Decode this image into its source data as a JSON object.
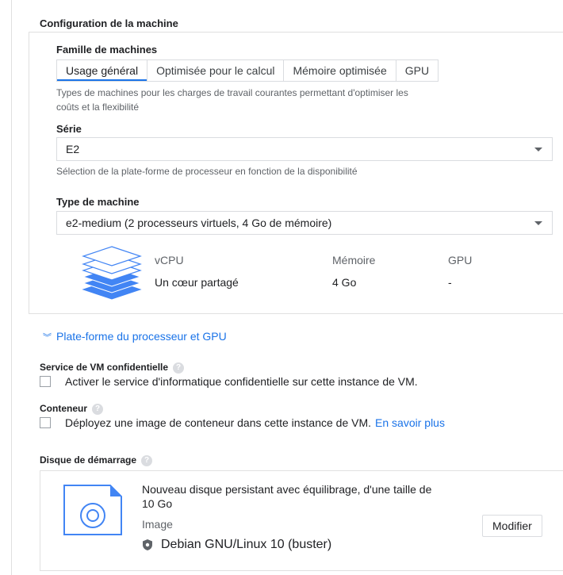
{
  "machine_config": {
    "title": "Configuration de la machine",
    "family": {
      "label": "Famille de machines",
      "tabs": [
        "Usage général",
        "Optimisée pour le calcul",
        "Mémoire optimisée",
        "GPU"
      ],
      "selected": "Usage général",
      "description_line1": "Types de machines pour les charges de travail courantes permettant d'optimiser les",
      "description_line2": "coûts et la flexibilité"
    },
    "series": {
      "label": "Série",
      "value": "E2",
      "hint": "Sélection de la plate-forme de processeur en fonction de la disponibilité"
    },
    "machine_type": {
      "label": "Type de machine",
      "value": "e2-medium (2 processeurs virtuels, 4 Go de mémoire)"
    },
    "specs": {
      "vcpu_header": "vCPU",
      "memory_header": "Mémoire",
      "gpu_header": "GPU",
      "vcpu_value": "Un cœur partagé",
      "memory_value": "4 Go",
      "gpu_value": "-"
    },
    "cpu_platform_link": "Plate-forme du processeur et GPU"
  },
  "confidential": {
    "title": "Service de VM confidentielle",
    "checkbox_label": "Activer le service d'informatique confidentielle sur cette instance de VM.",
    "checked": false
  },
  "container": {
    "title": "Conteneur",
    "checkbox_label": "Déployez une image de conteneur dans cette instance de VM.",
    "learn_more": "En savoir plus",
    "checked": false
  },
  "boot_disk": {
    "title": "Disque de démarrage",
    "description_line1": "Nouveau disque persistant avec équilibrage, d'une taille de",
    "description_line2": "10 Go",
    "image_label": "Image",
    "image_value": "Debian GNU/Linux 10 (buster)",
    "modify_button": "Modifier"
  },
  "colors": {
    "accent": "#1a73e8",
    "stack_blue": "#4285f4",
    "stack_light": "#c6dafc"
  }
}
